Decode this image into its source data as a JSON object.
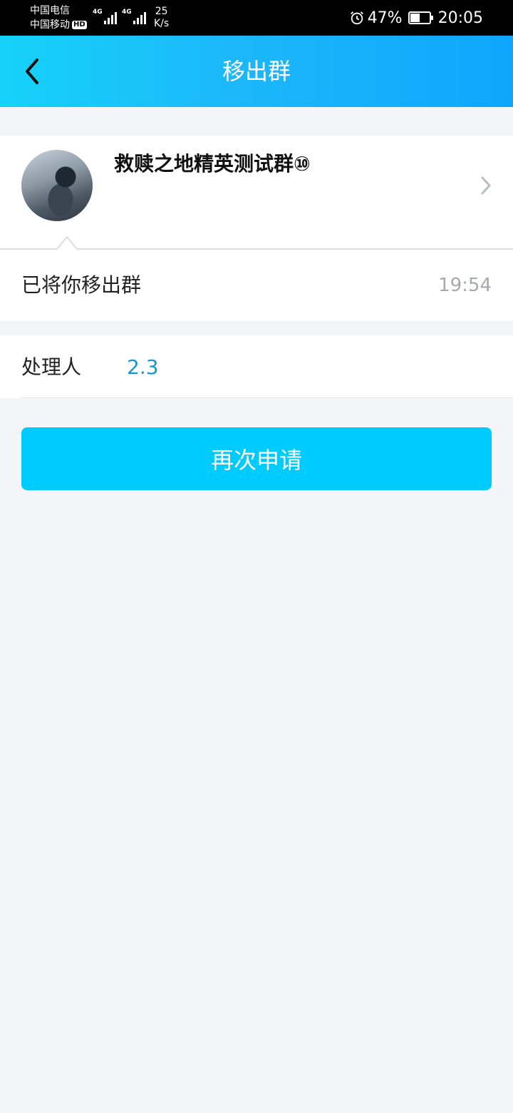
{
  "status_bar": {
    "carrier_1": "中国电信",
    "carrier_2": "中国移动",
    "hd_badge": "HD",
    "network_1": "4G",
    "network_2": "4G",
    "speed_value": "25",
    "speed_unit": "K/s",
    "battery_percent": "47%",
    "time": "20:05",
    "icons": [
      "alarm-icon",
      "battery-icon",
      "signal-icon"
    ]
  },
  "header": {
    "title": "移出群",
    "back_icon": "chevron-left-icon"
  },
  "group": {
    "name": "救赎之地精英测试群⑩",
    "avatar": "group-avatar-image",
    "arrow_icon": "chevron-right-icon"
  },
  "message": {
    "text": "已将你移出群",
    "time": "19:54"
  },
  "handler": {
    "label": "处理人",
    "value": "2.3"
  },
  "actions": {
    "reapply_label": "再次申请"
  },
  "colors": {
    "accent": "#00cbfe",
    "header_gradient_start": "#16d2f9",
    "header_gradient_end": "#0ea6fd",
    "handler_value": "#1596cf",
    "background": "#f3f5f9"
  }
}
